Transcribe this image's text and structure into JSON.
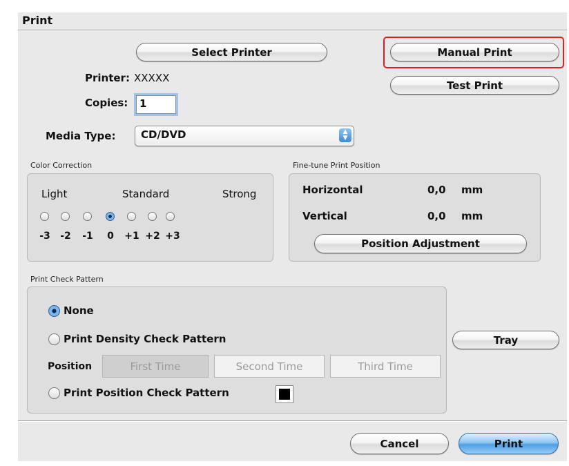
{
  "dialog": {
    "title": "Print"
  },
  "buttons": {
    "select_printer": "Select Printer",
    "manual_print": "Manual Print",
    "test_print": "Test Print",
    "position_adjustment": "Position Adjustment",
    "tray": "Tray",
    "cancel": "Cancel",
    "print": "Print"
  },
  "printer": {
    "label": "Printer:",
    "value": "XXXXX"
  },
  "copies": {
    "label": "Copies:",
    "value": "1"
  },
  "media_type": {
    "label": "Media Type:",
    "value": "CD/DVD"
  },
  "color_correction": {
    "title": "Color Correction",
    "light": "Light",
    "standard": "Standard",
    "strong": "Strong",
    "steps": [
      "-3",
      "-2",
      "-1",
      "0",
      "+1",
      "+2",
      "+3"
    ],
    "selected": "0"
  },
  "fine_tune": {
    "title": "Fine-tune Print Position",
    "horizontal_label": "Horizontal",
    "horizontal_value": "0,0",
    "vertical_label": "Vertical",
    "vertical_value": "0,0",
    "unit": "mm"
  },
  "check_pattern": {
    "title": "Print Check Pattern",
    "none": "None",
    "density": "Print Density Check Pattern",
    "position_label": "Position",
    "times": [
      "First Time",
      "Second Time",
      "Third Time"
    ],
    "position_pattern": "Print Position Check Pattern",
    "selected": "None"
  },
  "colors": {
    "highlight": "#e02020",
    "primary_button": "#4e9ee6"
  },
  "icons": {
    "select_arrows": "updown-arrows-icon",
    "swatch": "black-swatch-icon"
  }
}
